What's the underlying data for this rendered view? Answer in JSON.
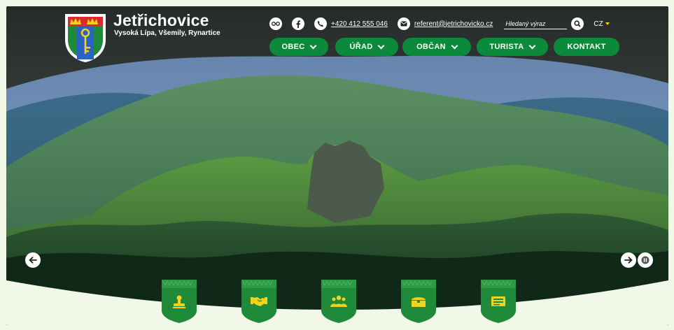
{
  "brand": {
    "title": "Jetřichovice",
    "subtitle": "Vysoká Lípa, Všemily, Rynartice"
  },
  "topbar": {
    "phone": "+420 412 555 046",
    "email": "referent@jetrichovicko.cz",
    "search_placeholder": "Hledaný výraz",
    "language": "CZ"
  },
  "nav": [
    {
      "label": "OBEC",
      "has_dropdown": true
    },
    {
      "label": "ÚŘAD",
      "has_dropdown": true
    },
    {
      "label": "OBČAN",
      "has_dropdown": true
    },
    {
      "label": "TURISTA",
      "has_dropdown": true
    },
    {
      "label": "KONTAKT",
      "has_dropdown": false
    }
  ],
  "icons": {
    "accessibility": "glasses-icon",
    "social": "facebook-icon",
    "phone": "phone-icon",
    "email": "envelope-icon",
    "search": "search-icon",
    "slider_prev": "arrow-left-icon",
    "slider_next": "arrow-right-icon",
    "slider_pause": "pause-icon"
  },
  "quick_links": [
    {
      "icon": "stamp-icon"
    },
    {
      "icon": "handshake-icon"
    },
    {
      "icon": "people-icon"
    },
    {
      "icon": "chest-icon"
    },
    {
      "icon": "newspaper-icon"
    }
  ],
  "colors": {
    "accent_green": "#0b8a3c",
    "header_dark": "#2b2f2d",
    "icon_yellow": "#f3d21b",
    "footer_bg": "#f2f8e8"
  }
}
